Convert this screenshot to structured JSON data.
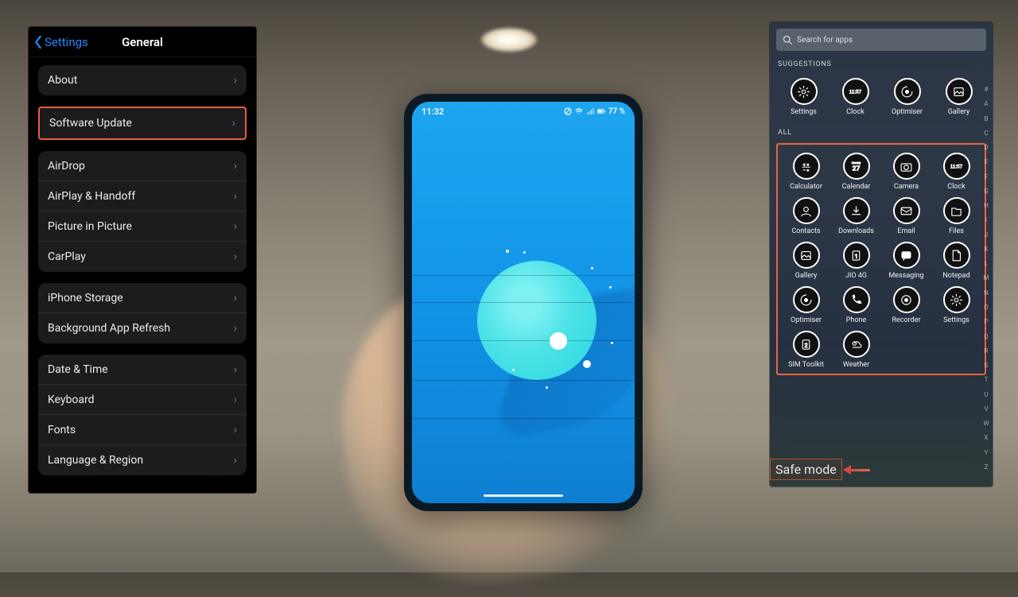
{
  "ios": {
    "back": "Settings",
    "title": "General",
    "groups": [
      [
        {
          "label": "About",
          "highlighted": false
        },
        {
          "label": "Software Update",
          "highlighted": true
        }
      ],
      [
        {
          "label": "AirDrop"
        },
        {
          "label": "AirPlay & Handoff"
        },
        {
          "label": "Picture in Picture"
        },
        {
          "label": "CarPlay"
        }
      ],
      [
        {
          "label": "iPhone Storage"
        },
        {
          "label": "Background App Refresh"
        }
      ],
      [
        {
          "label": "Date & Time"
        },
        {
          "label": "Keyboard"
        },
        {
          "label": "Fonts"
        },
        {
          "label": "Language & Region"
        }
      ]
    ]
  },
  "phone": {
    "time": "11:32",
    "battery": "77 %"
  },
  "android": {
    "search_placeholder": "Search for apps",
    "section_suggestions": "SUGGESTIONS",
    "section_all": "ALL",
    "suggestions": [
      {
        "name": "Settings",
        "icon": "gear"
      },
      {
        "name": "Clock",
        "icon": "clock",
        "face": "11:57"
      },
      {
        "name": "Optimiser",
        "icon": "optimiser"
      },
      {
        "name": "Gallery",
        "icon": "gallery"
      }
    ],
    "all": [
      {
        "name": "Calculator",
        "icon": "calculator"
      },
      {
        "name": "Calendar",
        "icon": "calendar",
        "face": "27",
        "top": "Monday"
      },
      {
        "name": "Camera",
        "icon": "camera"
      },
      {
        "name": "Clock",
        "icon": "clock",
        "face": "11:57"
      },
      {
        "name": "Contacts",
        "icon": "contacts"
      },
      {
        "name": "Downloads",
        "icon": "downloads"
      },
      {
        "name": "Email",
        "icon": "email"
      },
      {
        "name": "Files",
        "icon": "files"
      },
      {
        "name": "Gallery",
        "icon": "gallery"
      },
      {
        "name": "JIO 4G",
        "icon": "sim",
        "face": "1"
      },
      {
        "name": "Messaging",
        "icon": "messaging"
      },
      {
        "name": "Notepad",
        "icon": "notepad"
      },
      {
        "name": "Optimiser",
        "icon": "optimiser"
      },
      {
        "name": "Phone",
        "icon": "phone"
      },
      {
        "name": "Recorder",
        "icon": "recorder"
      },
      {
        "name": "Settings",
        "icon": "gear"
      },
      {
        "name": "SIM Toolkit",
        "icon": "sim",
        "face": "2"
      },
      {
        "name": "Weather",
        "icon": "weather"
      }
    ],
    "index": [
      "#",
      "A",
      "B",
      "C",
      "D",
      "E",
      "F",
      "G",
      "H",
      "I",
      "J",
      "K",
      "L",
      "M",
      "N",
      "O",
      "P",
      "Q",
      "R",
      "S",
      "T",
      "U",
      "V",
      "W",
      "X",
      "Y",
      "Z"
    ],
    "safe_mode": "Safe mode"
  }
}
